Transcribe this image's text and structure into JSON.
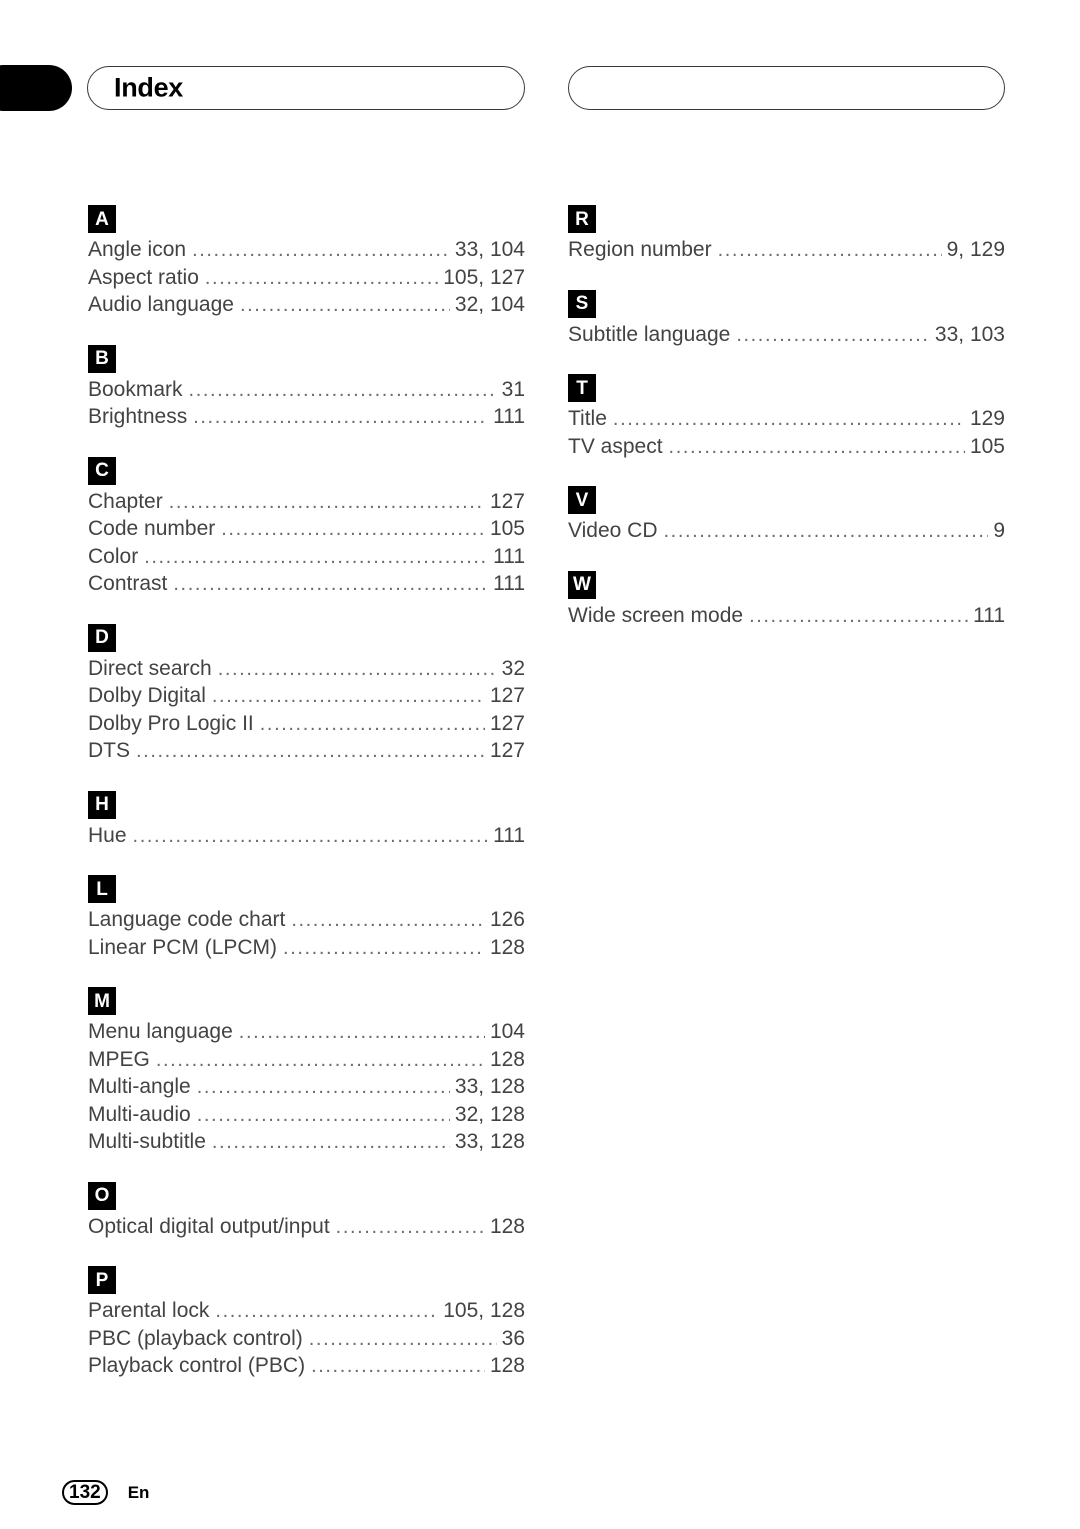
{
  "header": {
    "title": "Index",
    "left_box_label": "Index",
    "right_box_label": ""
  },
  "footer": {
    "page_number": "132",
    "language_code": "En"
  },
  "columns": [
    {
      "id": "left",
      "sections": [
        {
          "letter": "A",
          "entries": [
            {
              "term": "Angle icon",
              "pages": "33, 104"
            },
            {
              "term": "Aspect ratio",
              "pages": "105, 127"
            },
            {
              "term": "Audio language",
              "pages": "32, 104"
            }
          ]
        },
        {
          "letter": "B",
          "entries": [
            {
              "term": "Bookmark",
              "pages": "31"
            },
            {
              "term": "Brightness",
              "pages": "111"
            }
          ]
        },
        {
          "letter": "C",
          "entries": [
            {
              "term": "Chapter",
              "pages": "127"
            },
            {
              "term": "Code number",
              "pages": "105"
            },
            {
              "term": "Color",
              "pages": "111"
            },
            {
              "term": "Contrast",
              "pages": "111"
            }
          ]
        },
        {
          "letter": "D",
          "entries": [
            {
              "term": "Direct search",
              "pages": "32"
            },
            {
              "term": "Dolby Digital",
              "pages": "127"
            },
            {
              "term": "Dolby Pro Logic II",
              "pages": "127"
            },
            {
              "term": "DTS",
              "pages": "127"
            }
          ]
        },
        {
          "letter": "H",
          "entries": [
            {
              "term": "Hue",
              "pages": "111"
            }
          ]
        },
        {
          "letter": "L",
          "entries": [
            {
              "term": "Language code chart",
              "pages": "126"
            },
            {
              "term": "Linear PCM (LPCM)",
              "pages": "128"
            }
          ]
        },
        {
          "letter": "M",
          "entries": [
            {
              "term": "Menu language",
              "pages": "104"
            },
            {
              "term": "MPEG",
              "pages": "128"
            },
            {
              "term": "Multi-angle",
              "pages": "33, 128"
            },
            {
              "term": "Multi-audio",
              "pages": "32, 128"
            },
            {
              "term": "Multi-subtitle",
              "pages": "33, 128"
            }
          ]
        },
        {
          "letter": "O",
          "entries": [
            {
              "term": "Optical digital output/input",
              "pages": "128"
            }
          ]
        },
        {
          "letter": "P",
          "entries": [
            {
              "term": "Parental lock",
              "pages": "105, 128"
            },
            {
              "term": "PBC (playback control)",
              "pages": "36"
            },
            {
              "term": "Playback control (PBC)",
              "pages": "128"
            }
          ]
        }
      ]
    },
    {
      "id": "right",
      "sections": [
        {
          "letter": "R",
          "entries": [
            {
              "term": "Region number",
              "pages": "9, 129"
            }
          ]
        },
        {
          "letter": "S",
          "entries": [
            {
              "term": "Subtitle language",
              "pages": "33, 103"
            }
          ]
        },
        {
          "letter": "T",
          "entries": [
            {
              "term": "Title",
              "pages": "129"
            },
            {
              "term": "TV aspect",
              "pages": "105"
            }
          ]
        },
        {
          "letter": "V",
          "entries": [
            {
              "term": "Video CD",
              "pages": "9"
            }
          ]
        },
        {
          "letter": "W",
          "entries": [
            {
              "term": "Wide screen mode",
              "pages": "111"
            }
          ]
        }
      ]
    }
  ],
  "colors": {
    "badge_background": "#000000",
    "badge_text": "#ffffff",
    "entry_text": "#434343",
    "leader_dots": "#6a6a6a",
    "page_background": "#ffffff"
  }
}
